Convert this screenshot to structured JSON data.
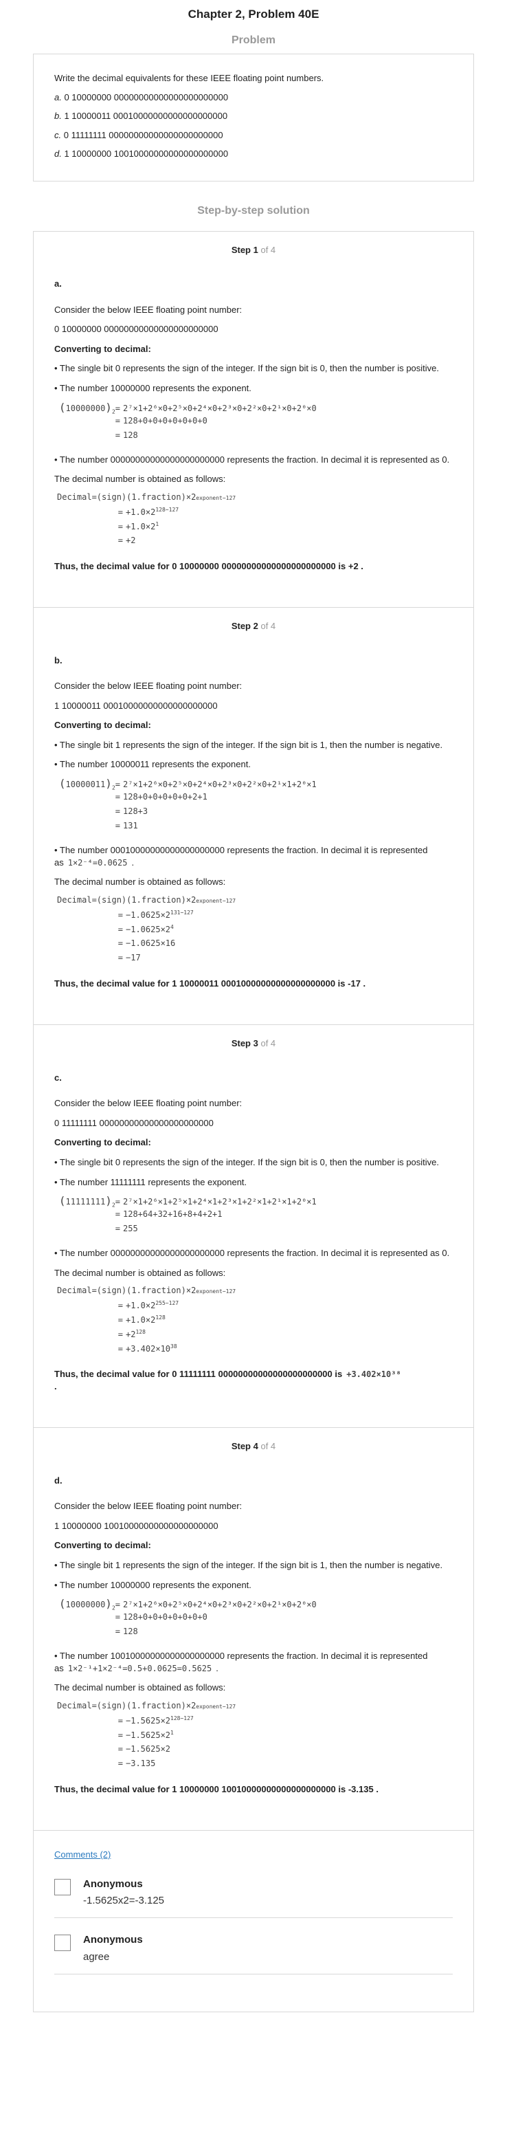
{
  "title": "Chapter 2, Problem 40E",
  "problem": {
    "heading": "Problem",
    "intro": "Write the decimal equivalents for these IEEE floating point numbers.",
    "items": [
      {
        "label": "a.",
        "value": "0 10000000 00000000000000000000000"
      },
      {
        "label": "b.",
        "value": "1 10000011 00010000000000000000000"
      },
      {
        "label": "c.",
        "value": "0 11111111 00000000000000000000000"
      },
      {
        "label": "d.",
        "value": "1 10000000 10010000000000000000000"
      }
    ]
  },
  "solution_heading": "Step-by-step solution",
  "steps": [
    {
      "step_label": "Step 1",
      "step_of": "of 4",
      "part": "a.",
      "consider": "Consider the below IEEE floating point number:",
      "number": "0 10000000 00000000000000000000000",
      "converting": "Converting to decimal:",
      "sign_text": "• The single bit 0 represents the sign of the integer. If the sign bit is 0, then the number is positive.",
      "exp_text": "• The number 10000000 represents the exponent.",
      "exp_lhs": "10000000",
      "exp_lines": [
        "2⁷×1+2⁶×0+2⁵×0+2⁴×0+2³×0+2²×0+2¹×0+2⁰×0",
        "128+0+0+0+0+0+0+0",
        "128"
      ],
      "frac_text": "• The number 00000000000000000000000 represents the fraction. In decimal it is represented as 0.",
      "frac_math": "",
      "obtained": "The decimal number is obtained as follows:",
      "dec_lines": [
        "+1.0×2^(128−127)",
        "+1.0×2^1",
        "+2"
      ],
      "conclusion": "Thus, the decimal value for 0 10000000 00000000000000000000000 is +2 ."
    },
    {
      "step_label": "Step 2",
      "step_of": "of 4",
      "part": "b.",
      "consider": "Consider the below IEEE floating point number:",
      "number": "1 10000011 00010000000000000000000",
      "converting": "Converting to decimal:",
      "sign_text": "• The single bit 1 represents the sign of the integer. If the sign bit is 1, then the number is negative.",
      "exp_text": "• The number 10000011 represents the exponent.",
      "exp_lhs": "10000011",
      "exp_lines": [
        "2⁷×1+2⁶×0+2⁵×0+2⁴×0+2³×0+2²×0+2¹×1+2⁰×1",
        "128+0+0+0+0+0+2+1",
        "128+3",
        "131"
      ],
      "frac_text": "• The number 00010000000000000000000 represents the fraction. In decimal it is represented as",
      "frac_math": "1×2⁻⁴=0.0625",
      "obtained": "The decimal number is obtained as follows:",
      "dec_lines": [
        "−1.0625×2^(131−127)",
        "−1.0625×2^4",
        "−1.0625×16",
        "−17"
      ],
      "conclusion": "Thus, the decimal value for 1 10000011 00010000000000000000000 is -17 ."
    },
    {
      "step_label": "Step 3",
      "step_of": "of 4",
      "part": "c.",
      "consider": "Consider the below IEEE floating point number:",
      "number": "0 11111111 00000000000000000000000",
      "converting": "Converting to decimal:",
      "sign_text": "• The single bit 0 represents the sign of the integer. If the sign bit is 0, then the number is positive.",
      "exp_text": "• The number 11111111 represents the exponent.",
      "exp_lhs": "11111111",
      "exp_lines": [
        "2⁷×1+2⁶×1+2⁵×1+2⁴×1+2³×1+2²×1+2¹×1+2⁰×1",
        "128+64+32+16+8+4+2+1",
        "255"
      ],
      "frac_text": "• The number 00000000000000000000000 represents the fraction. In decimal it is represented as 0.",
      "frac_math": "",
      "obtained": "The decimal number is obtained as follows:",
      "dec_lines": [
        "+1.0×2^(255−127)",
        "+1.0×2^128",
        "+2^128",
        "+3.402×10^38"
      ],
      "conclusion": "Thus, the decimal value for 0 11111111 00000000000000000000000 is",
      "conclusion_math": "+3.402×10³⁸"
    },
    {
      "step_label": "Step 4",
      "step_of": "of 4",
      "part": "d.",
      "consider": "Consider the below IEEE floating point number:",
      "number": "1 10000000 10010000000000000000000",
      "converting": "Converting to decimal:",
      "sign_text": "• The single bit 1 represents the sign of the integer. If the sign bit is 1, then the number is negative.",
      "exp_text": "• The number 10000000 represents the exponent.",
      "exp_lhs": "10000000",
      "exp_lines": [
        "2⁷×1+2⁶×0+2⁵×0+2⁴×0+2³×0+2²×0+2¹×0+2⁰×0",
        "128+0+0+0+0+0+0+0",
        "128"
      ],
      "frac_text": "• The number 10010000000000000000000 represents the fraction. In decimal it is represented as",
      "frac_math": "1×2⁻¹+1×2⁻⁴=0.5+0.0625=0.5625",
      "obtained": "The decimal number is obtained as follows:",
      "dec_lines": [
        "−1.5625×2^(128−127)",
        "−1.5625×2^1",
        "−1.5625×2",
        "−3.135"
      ],
      "conclusion": "Thus, the decimal value for 1 10000000 10010000000000000000000 is -3.135 ."
    }
  ],
  "decimal_lhs": "Decimal=(sign)(1.fraction)×2",
  "decimal_sup": "exponent−127",
  "comments": {
    "link_label": "Comments (2)",
    "items": [
      {
        "author": "Anonymous",
        "text": "-1.5625x2=-3.125"
      },
      {
        "author": "Anonymous",
        "text": "agree"
      }
    ]
  }
}
